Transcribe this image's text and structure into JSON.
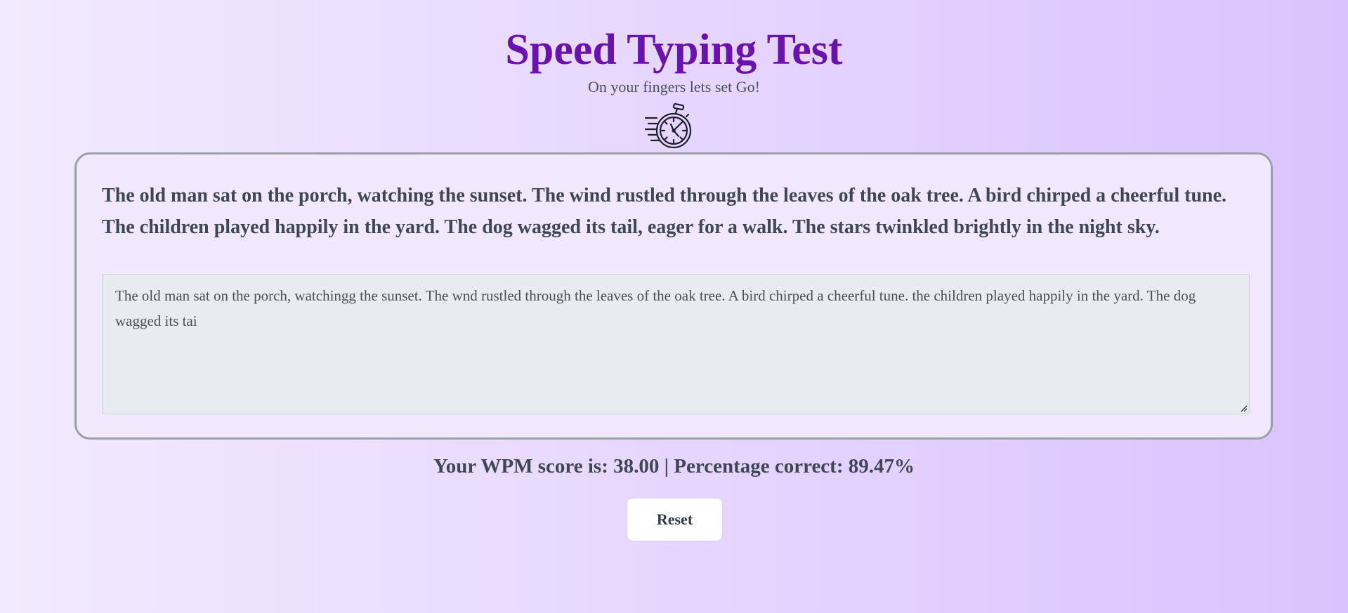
{
  "header": {
    "title": "Speed Typing Test",
    "subtitle": "On your fingers lets set Go!",
    "icon": "stopwatch-icon"
  },
  "test": {
    "prompt_text": "The old man sat on the porch, watching the sunset. The wind rustled through the leaves of the oak tree. A bird chirped a cheerful tune. The children played happily in the yard. The dog wagged its tail, eager for a walk. The stars twinkled brightly in the night sky.",
    "typed_text": "The old man sat on the porch, watchingg the sunset. The wnd rustled through the leaves of the oak tree. A bird chirped a cheerful tune. the children played happily in the yard. The dog wagged its tai"
  },
  "result": {
    "score_text": "Your WPM score is: 38.00 | Percentage correct: 89.47%"
  },
  "actions": {
    "reset_label": "Reset"
  },
  "colors": {
    "title": "#6a12ad",
    "background_start": "#f2eafe",
    "background_end": "#d9c3fe",
    "card_background": "#f1e8fe",
    "card_border": "#9aa0a8",
    "input_background": "#e8ebef"
  }
}
